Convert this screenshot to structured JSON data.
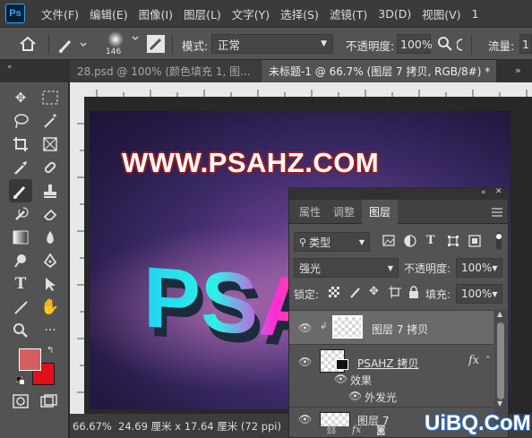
{
  "app": {
    "logo": "Ps"
  },
  "menu": [
    "文件(F)",
    "编辑(E)",
    "图像(I)",
    "图层(L)",
    "文字(Y)",
    "选择(S)",
    "滤镜(T)",
    "3D(D)",
    "视图(V)",
    "1"
  ],
  "options": {
    "brush_size": "146",
    "mode_label": "模式:",
    "mode_value": "正常",
    "opacity_label": "不透明度:",
    "opacity_value": "100%",
    "flow_label": "流量:",
    "flow_value": "1"
  },
  "tabs": [
    {
      "label": "28.psd @ 100% (颜色填充 1, 图...",
      "active": false
    },
    {
      "label": "未标题-1 @ 66.7% (图层 7 拷贝, RGB/8#) *",
      "active": true
    }
  ],
  "canvas": {
    "headline": "WWW.PSAHZ.COM",
    "art_text": "PSAH"
  },
  "colors": {
    "foreground": "#d35f5f",
    "background": "#e0101a"
  },
  "status": {
    "zoom": "66.67%",
    "doc_size": "24.69 厘米 x 17.64 厘米 (72 ppi)"
  },
  "layers_panel": {
    "tabs": [
      {
        "label": "属性",
        "active": false
      },
      {
        "label": "调整",
        "active": false
      },
      {
        "label": "图层",
        "active": true
      }
    ],
    "filter_kind": "类型",
    "blend_mode": "强光",
    "opacity_label": "不透明度:",
    "opacity_value": "100%",
    "lock_label": "锁定:",
    "fill_label": "填充:",
    "fill_value": "100%",
    "layers": [
      {
        "name": "图层 7 拷贝",
        "selected": true
      },
      {
        "name": "PSAHZ 拷贝",
        "fx": "fx"
      },
      {
        "name": "图层 7",
        "selected": false
      }
    ],
    "effects_label": "效果",
    "effect_item": "外发光"
  },
  "watermark": "UiBQ.CoM"
}
